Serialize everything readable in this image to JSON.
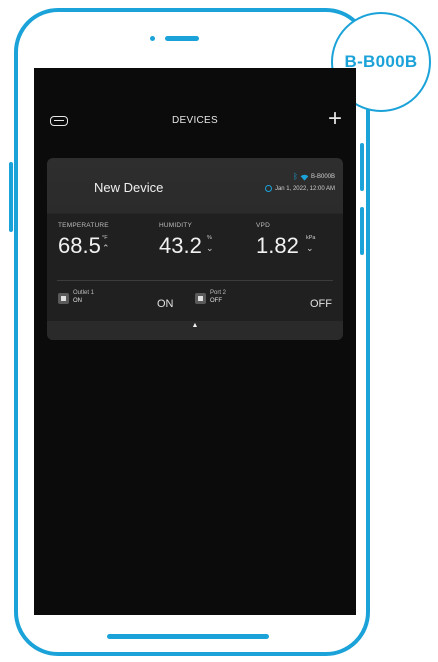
{
  "badge": {
    "label": "B-B000B"
  },
  "header": {
    "title": "DEVICES",
    "add_label": "+"
  },
  "device": {
    "name": "New Device",
    "device_id": "B-B000B",
    "timestamp": "Jan 1, 2022, 12:00 AM",
    "metrics": [
      {
        "label": "TEMPERATURE",
        "value": "68.5",
        "unit": "°F"
      },
      {
        "label": "HUMIDITY",
        "value": "43.2",
        "unit": "%"
      },
      {
        "label": "VPD",
        "value": "1.82",
        "unit": "kPa"
      }
    ],
    "outlets": [
      {
        "name": "Outlet 1",
        "sub": "ON",
        "state": "ON"
      },
      {
        "name": "Port 2",
        "sub": "OFF",
        "state": "OFF"
      }
    ]
  },
  "icons": {
    "menu": "menu-icon",
    "add": "plus-icon",
    "bluetooth": "bluetooth-icon",
    "wifi": "wifi-icon",
    "clock": "clock-icon",
    "expand": "chevron-up-icon"
  },
  "colors": {
    "accent": "#1ba3d9",
    "screen": "#0b0b0b",
    "card": "#2e2e2e"
  }
}
